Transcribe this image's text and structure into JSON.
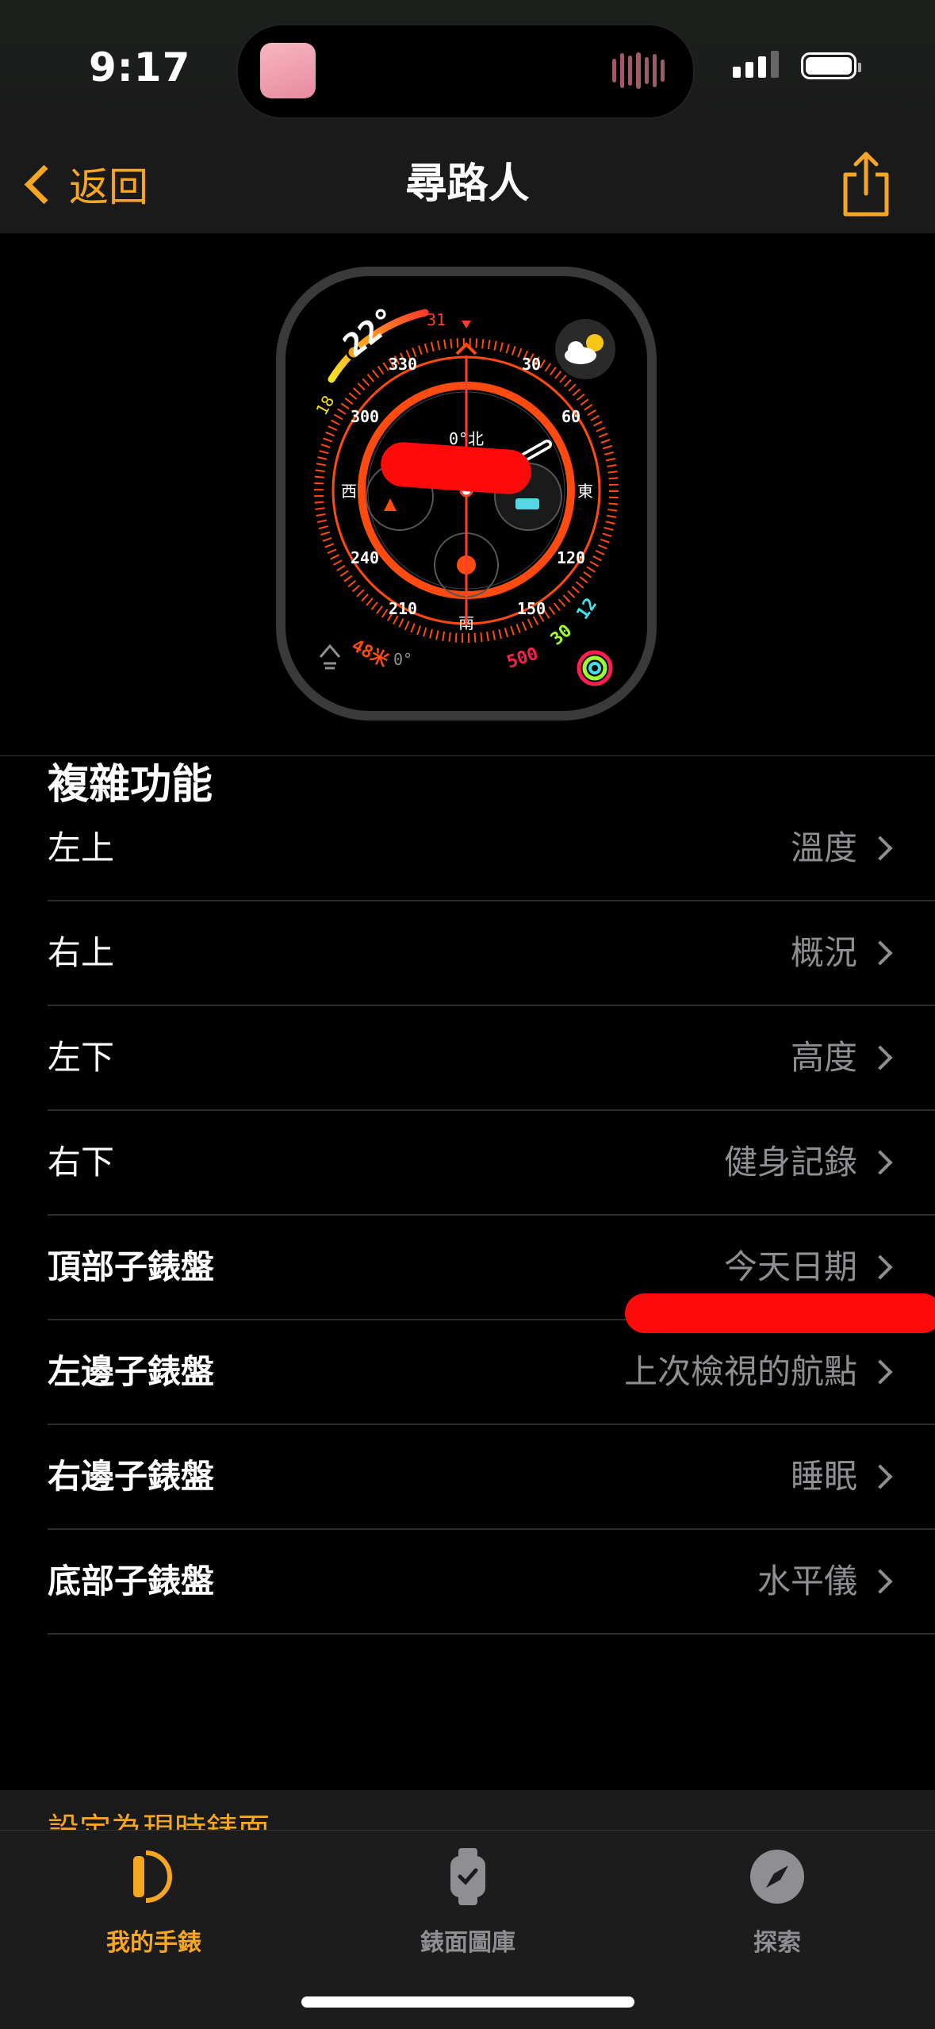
{
  "status": {
    "time": "9:17"
  },
  "nav": {
    "back_label": "返回",
    "title": "尋路人",
    "share_icon": "share-icon"
  },
  "watch_face": {
    "temperature": "22°",
    "temp_low": "18",
    "temp_high": "31",
    "bezel_numbers": [
      "330",
      "30",
      "60",
      "300",
      "120",
      "240",
      "210",
      "150"
    ],
    "directions": {
      "north": "北",
      "east": "東",
      "south": "南",
      "west": "西"
    },
    "compass_reading": "0°北",
    "altitude": "48米",
    "level": "0°",
    "activity_values": [
      "500",
      "30",
      "12"
    ]
  },
  "complications": {
    "section_title": "複雜功能",
    "rows": [
      {
        "label": "左上",
        "value": "溫度"
      },
      {
        "label": "右上",
        "value": "概況"
      },
      {
        "label": "左下",
        "value": "高度"
      },
      {
        "label": "右下",
        "value": "健身記錄"
      },
      {
        "label": "頂部子錶盤",
        "value": "今天日期"
      },
      {
        "label": "左邊子錶盤",
        "value": "上次檢視的航點"
      },
      {
        "label": "右邊子錶盤",
        "value": "睡眠"
      },
      {
        "label": "底部子錶盤",
        "value": "水平儀"
      }
    ]
  },
  "peek_link": "設定為現時錶面",
  "tabs": [
    {
      "label": "我的手錶",
      "icon": "watch-icon",
      "active": true
    },
    {
      "label": "錶面圖庫",
      "icon": "watch-gallery-icon",
      "active": false
    },
    {
      "label": "探索",
      "icon": "compass-icon",
      "active": false
    }
  ],
  "colors": {
    "accent": "#f5a623",
    "bezel": "#ff4a10",
    "redaction": "#ff0a0a"
  }
}
